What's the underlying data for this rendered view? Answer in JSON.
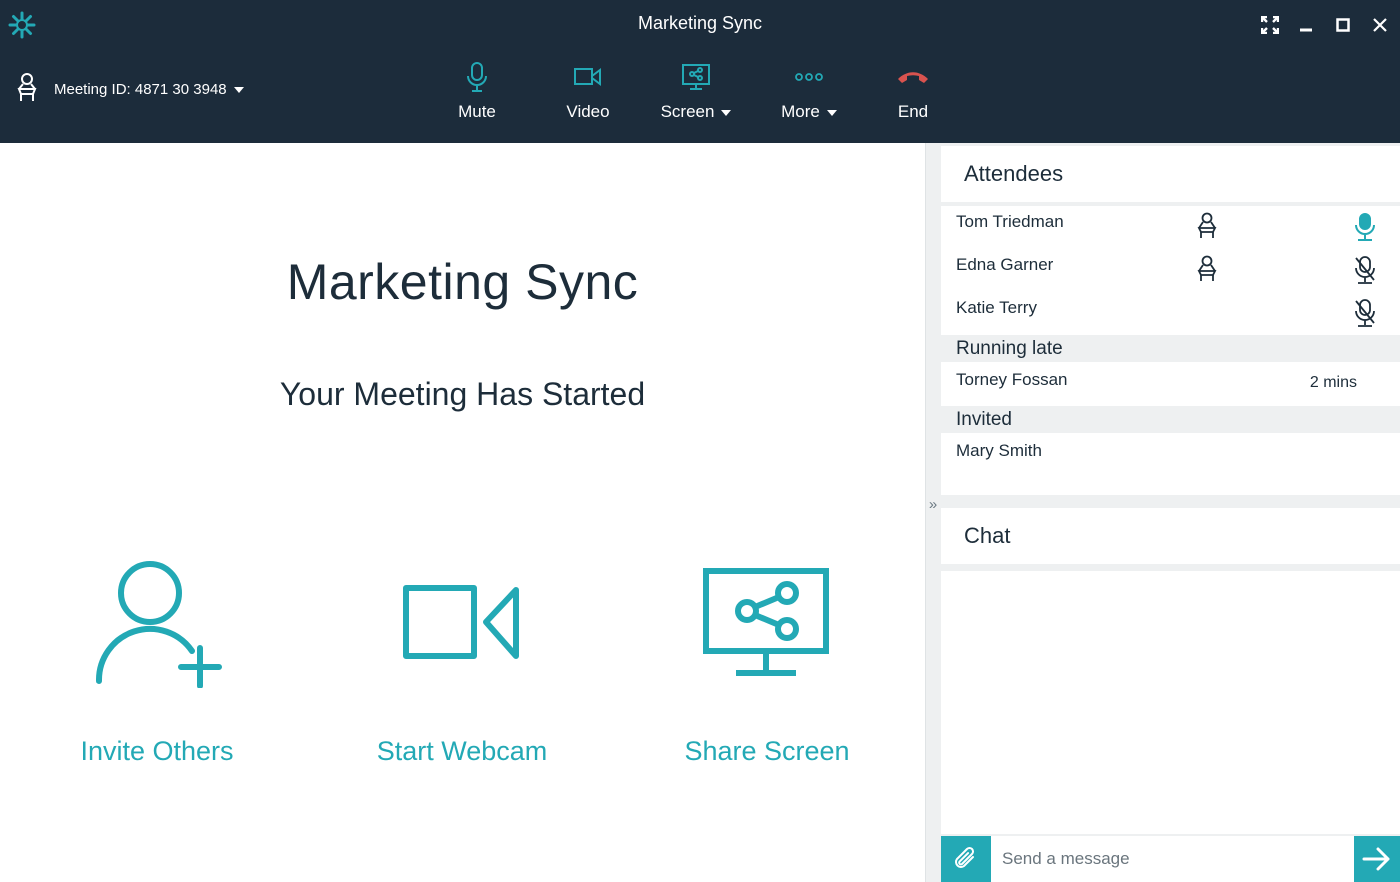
{
  "window": {
    "title": "Marketing Sync",
    "icons": {
      "logo": "app-logo-icon",
      "fullscreen": "fullscreen-icon",
      "minimize": "minimize-icon",
      "maximize": "maximize-icon",
      "close": "close-icon"
    }
  },
  "header": {
    "meeting_id_label": "Meeting ID: 4871 30 3948",
    "toolbar": [
      {
        "label": "Mute",
        "icon": "microphone-icon",
        "dropdown": false
      },
      {
        "label": "Video",
        "icon": "video-camera-icon",
        "dropdown": false
      },
      {
        "label": "Screen",
        "icon": "screen-share-icon",
        "dropdown": true
      },
      {
        "label": "More",
        "icon": "more-dots-icon",
        "dropdown": true
      },
      {
        "label": "End",
        "icon": "hang-up-icon",
        "dropdown": false
      }
    ]
  },
  "main": {
    "title": "Marketing Sync",
    "status": "Your Meeting Has Started",
    "actions": [
      {
        "label": "Invite Others",
        "icon": "add-user-icon"
      },
      {
        "label": "Start Webcam",
        "icon": "webcam-icon"
      },
      {
        "label": "Share Screen",
        "icon": "share-screen-icon"
      }
    ]
  },
  "attendees": {
    "heading": "Attendees",
    "present": [
      {
        "name": "Tom Triedman",
        "host": true,
        "mic": "on"
      },
      {
        "name": "Edna Garner",
        "host": true,
        "mic": "muted"
      },
      {
        "name": "Katie Terry",
        "host": false,
        "mic": "muted"
      }
    ],
    "running_late_heading": "Running late",
    "running_late": [
      {
        "name": "Torney Fossan",
        "eta": "2 mins"
      }
    ],
    "invited_heading": "Invited",
    "invited": [
      {
        "name": "Mary Smith"
      }
    ]
  },
  "chat": {
    "heading": "Chat",
    "input_placeholder": "Send a message"
  },
  "colors": {
    "topbar": "#1c2c3b",
    "accent": "#23a9b5",
    "text": "#1d2d3a",
    "panel_bg": "#eef0f1",
    "end_red": "#d9534f"
  }
}
